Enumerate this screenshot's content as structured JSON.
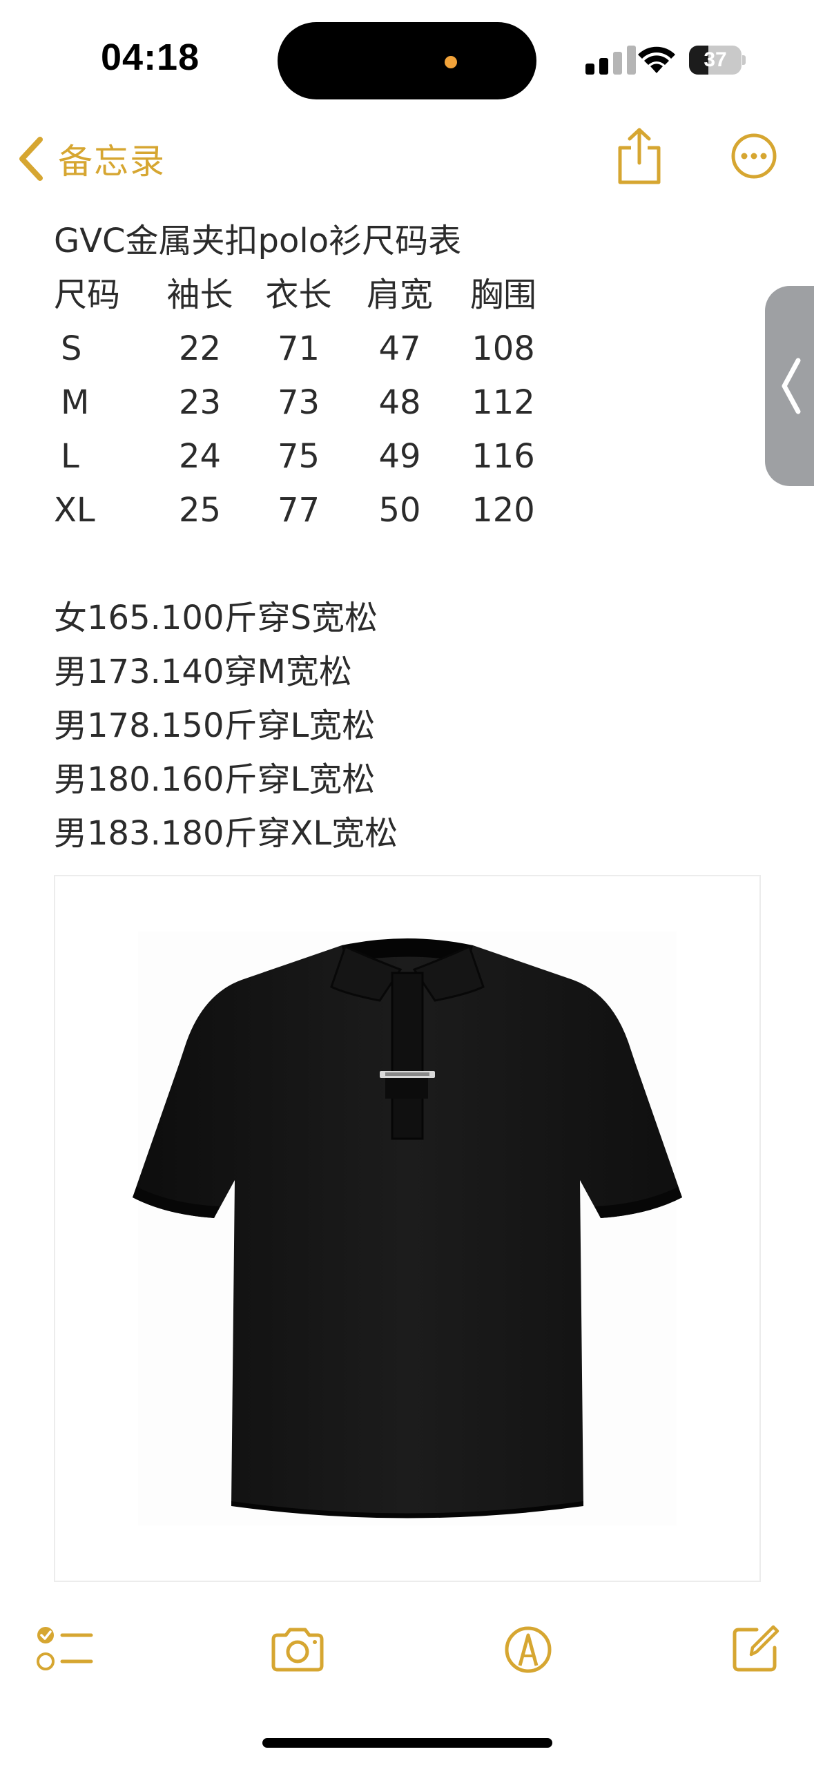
{
  "status_bar": {
    "time": "04:18",
    "battery_level": "37",
    "battery_fraction": 0.37,
    "signal_bars_active": 2,
    "signal_bars_total": 4
  },
  "nav": {
    "back_label": "备忘录",
    "accent_color": "#d6a631"
  },
  "note": {
    "title": "GVC金属夹扣polo衫尺码表",
    "table": {
      "headers": [
        "尺码",
        "袖长",
        "衣长",
        "肩宽",
        "胸围"
      ],
      "rows": [
        [
          "S",
          "22",
          "71",
          "47",
          "108"
        ],
        [
          "M",
          "23",
          "73",
          "48",
          "112"
        ],
        [
          "L",
          "24",
          "75",
          "49",
          "116"
        ],
        [
          "XL",
          "25",
          "77",
          "50",
          "120"
        ]
      ]
    },
    "recommendations": [
      "女165.100斤穿S宽松",
      "男173.140穿M宽松",
      "男178.150斤穿L宽松",
      "男180.160斤穿L宽松",
      "男183.180斤穿XL宽松"
    ]
  },
  "attachment": {
    "icon": "black-polo-shirt-image"
  },
  "toolbar": {
    "icons": [
      "checklist-icon",
      "camera-icon",
      "markup-icon",
      "compose-icon"
    ]
  }
}
